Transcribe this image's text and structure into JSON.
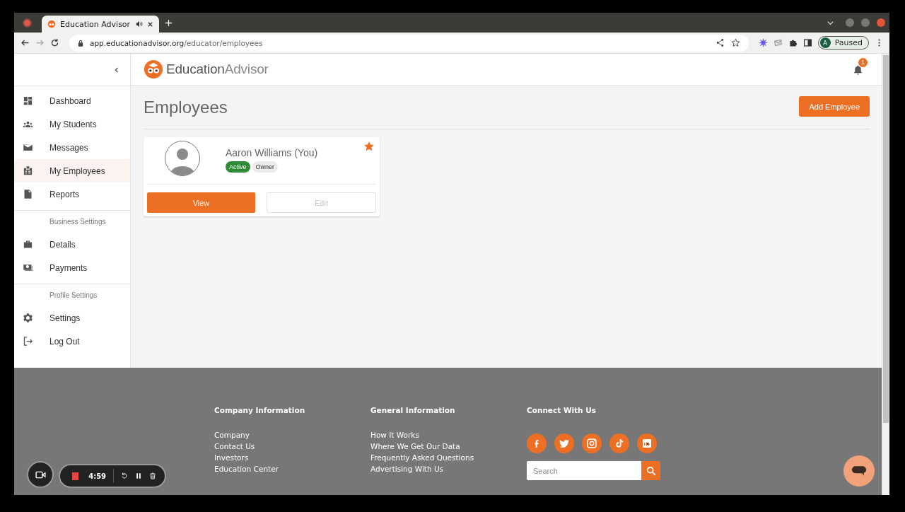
{
  "browser": {
    "tab": {
      "title": "Education Advisor"
    },
    "url_host": "app.educationadvisor.org",
    "url_path": "/educator/employees",
    "forward_disabled": true,
    "profile": {
      "initial": "A",
      "status": "Paused"
    }
  },
  "header": {
    "logo_dark": "Education",
    "logo_light": "Advisor",
    "notification_count": "1"
  },
  "sidebar": {
    "groups": [
      {
        "items": [
          {
            "label": "Dashboard",
            "selected": false
          },
          {
            "label": "My Students",
            "selected": false
          },
          {
            "label": "Messages",
            "selected": false
          },
          {
            "label": "My Employees",
            "selected": true
          },
          {
            "label": "Reports",
            "selected": false
          }
        ]
      },
      {
        "heading": "Business Settings",
        "items": [
          {
            "label": "Details",
            "selected": false
          },
          {
            "label": "Payments",
            "selected": false
          }
        ]
      },
      {
        "heading": "Profile Settings",
        "items": [
          {
            "label": "Settings",
            "selected": false
          },
          {
            "label": "Log Out",
            "selected": false
          }
        ]
      }
    ]
  },
  "page": {
    "title": "Employees",
    "add_button": "Add Employee"
  },
  "employees": [
    {
      "name": "Aaron Williams (You)",
      "favorite": true,
      "status": "Active",
      "role": "Owner",
      "view_label": "View",
      "edit_label": "Edit",
      "edit_disabled": true
    }
  ],
  "footer": {
    "columns": [
      {
        "heading": "Company Information",
        "links": [
          "Company",
          "Contact Us",
          "Investors",
          "Education Center"
        ]
      },
      {
        "heading": "General Information",
        "links": [
          "How It Works",
          "Where We Get Our Data",
          "Frequently Asked Questions",
          "Advertising With Us"
        ]
      }
    ],
    "connect": {
      "heading": "Connect With Us",
      "search": {
        "placeholder": "Search"
      }
    }
  },
  "recorder": {
    "time": "4:59"
  }
}
